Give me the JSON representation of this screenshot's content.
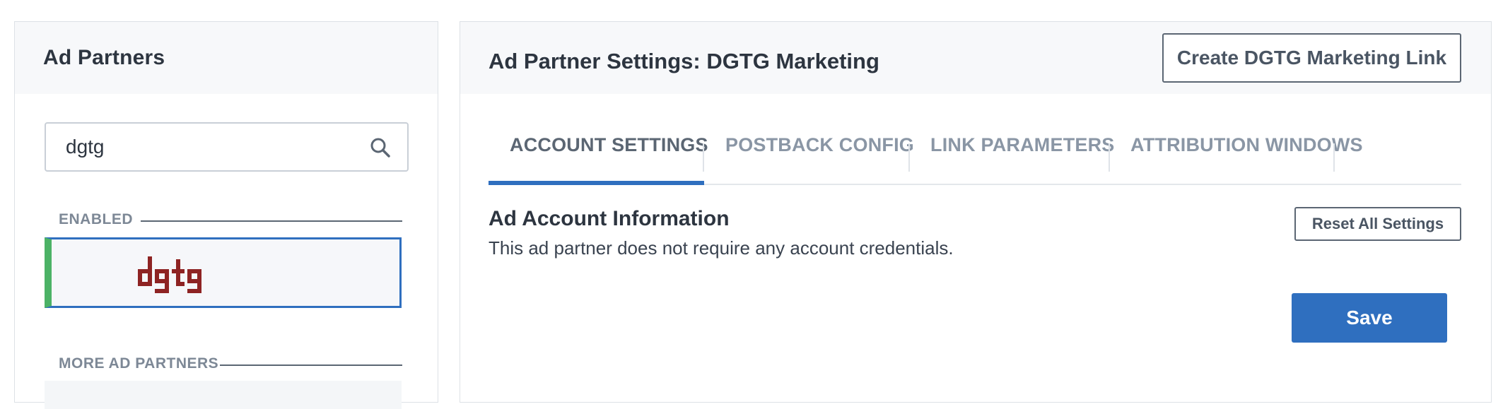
{
  "left_panel": {
    "title": "Ad Partners",
    "search": {
      "value": "dgtg",
      "placeholder": ""
    },
    "enabled_label": "ENABLED",
    "more_label": "MORE AD PARTNERS",
    "enabled_partners": [
      {
        "logo_text": "dgtg",
        "logo_color": "#8e2323",
        "status_color": "#4cb266"
      }
    ]
  },
  "right_panel": {
    "title": "Ad Partner Settings: DGTG Marketing",
    "create_link_label": "Create DGTG Marketing Link",
    "tabs": [
      {
        "label": "ACCOUNT SETTINGS",
        "active": true
      },
      {
        "label": "POSTBACK CONFIG",
        "active": false
      },
      {
        "label": "LINK PARAMETERS",
        "active": false
      },
      {
        "label": "ATTRIBUTION WINDOWS",
        "active": false
      }
    ],
    "section_title": "Ad Account Information",
    "section_desc": "This ad partner does not require any account credentials.",
    "reset_label": "Reset All Settings",
    "save_label": "Save"
  },
  "colors": {
    "accent": "#2f6fbf",
    "enabled": "#4cb266",
    "logo": "#8e2323"
  },
  "icons": {
    "search": "search-icon"
  }
}
